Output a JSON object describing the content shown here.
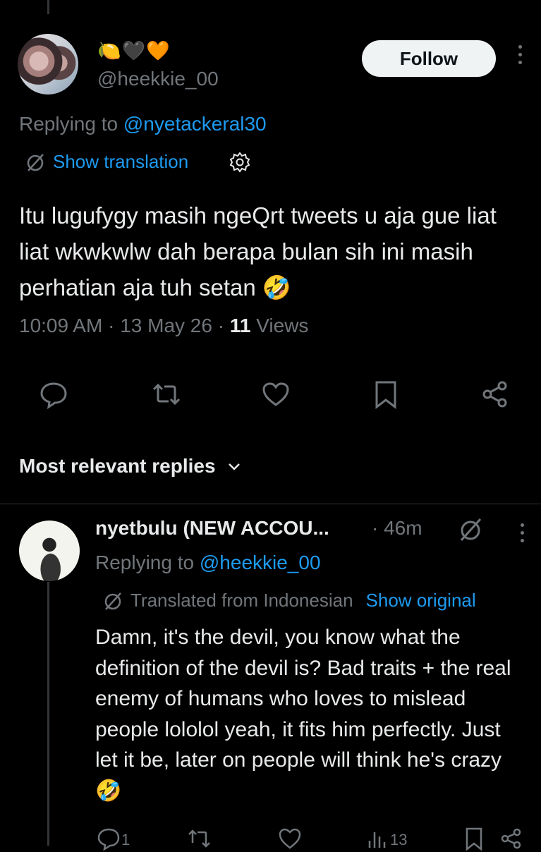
{
  "tweet": {
    "author_emojis": "🍋🖤🧡",
    "handle": "@heekkie_00",
    "follow_label": "Follow",
    "replying_prefix": "Replying to ",
    "replying_to": "@nyetackeral30",
    "show_translation": "Show translation",
    "text": "Itu lugufygy masih ngeQrt tweets u aja gue liat liat wkwkwlw dah berapa bulan sih ini masih perhatian aja tuh setan 🤣",
    "time": "10:09 AM",
    "date": "13 May 26",
    "views_count": "11",
    "views_label": "Views"
  },
  "replies_section": {
    "title": "Most relevant replies"
  },
  "reply": {
    "name": "nyetbulu (NEW ACCOU...",
    "time": "46m",
    "replying_prefix": "Replying to ",
    "replying_to": "@heekkie_00",
    "translated_label": "Translated from Indonesian",
    "show_original": "Show original",
    "text": "Damn, it's the devil, you know what the definition of the devil is? Bad traits + the real enemy of humans who loves to mislead people lololol yeah, it fits him perfectly. Just let it be, later on people will think he's crazy 🤣",
    "reply_count": "1",
    "views_count": "13"
  },
  "colors": {
    "background": "#000000",
    "text": "#e7e9ea",
    "muted": "#71767b",
    "accent": "#1d9bf0"
  }
}
